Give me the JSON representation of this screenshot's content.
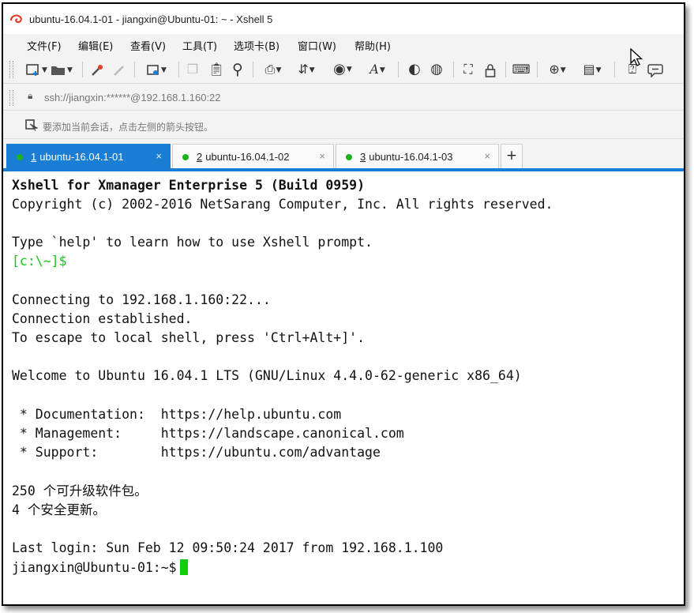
{
  "window": {
    "title": "ubuntu-16.04.1-01 - jiangxin@Ubuntu-01: ~ - Xshell 5"
  },
  "menu": {
    "items": [
      {
        "label": "文件(F)"
      },
      {
        "label": "编辑(E)"
      },
      {
        "label": "查看(V)"
      },
      {
        "label": "工具(T)"
      },
      {
        "label": "选项卡(B)"
      },
      {
        "label": "窗口(W)"
      },
      {
        "label": "帮助(H)"
      }
    ]
  },
  "toolbar": {
    "icons": [
      "new-session-icon",
      "open-folder-icon",
      "reconnect-icon",
      "disconnect-icon",
      "properties-icon",
      "copy-icon",
      "paste-icon",
      "find-icon",
      "print-icon",
      "transfer-icon",
      "globe-icon",
      "font-icon",
      "xftp-icon",
      "xmanager-icon",
      "fullscreen-icon",
      "lock-icon",
      "keyboard-icon",
      "new-tab-icon",
      "layout-icon",
      "help-icon",
      "chat-icon"
    ]
  },
  "address": {
    "text": "ssh://jiangxin:******@192.168.1.160:22"
  },
  "hint": {
    "text": "要添加当前会话，点击左侧的箭头按钮。"
  },
  "tabs": [
    {
      "num": "1",
      "label": "ubuntu-16.04.1-01",
      "active": true,
      "close": "×"
    },
    {
      "num": "2",
      "label": "ubuntu-16.04.1-02",
      "active": false,
      "close": "×"
    },
    {
      "num": "3",
      "label": "ubuntu-16.04.1-03",
      "active": false,
      "close": "×"
    }
  ],
  "tab_add": "+",
  "terminal": {
    "lines": [
      "Xshell for Xmanager Enterprise 5 (Build 0959)",
      "Copyright (c) 2002-2016 NetSarang Computer, Inc. All rights reserved.",
      "",
      "Type `help' to learn how to use Xshell prompt.",
      "[c:\\~]$",
      "",
      "Connecting to 192.168.1.160:22...",
      "Connection established.",
      "To escape to local shell, press 'Ctrl+Alt+]'.",
      "",
      "Welcome to Ubuntu 16.04.1 LTS (GNU/Linux 4.4.0-62-generic x86_64)",
      "",
      " * Documentation:  https://help.ubuntu.com",
      " * Management:     https://landscape.canonical.com",
      " * Support:        https://ubuntu.com/advantage",
      "",
      "250 个可升级软件包。",
      "4 个安全更新。",
      "",
      "Last login: Sun Feb 12 09:50:24 2017 from 192.168.1.100",
      "jiangxin@Ubuntu-01:~$"
    ]
  },
  "colors": {
    "accent": "#1a7fd4",
    "prompt_green": "#18c718",
    "status_dot": "#1eb11e",
    "cursor": "#11cc11"
  }
}
